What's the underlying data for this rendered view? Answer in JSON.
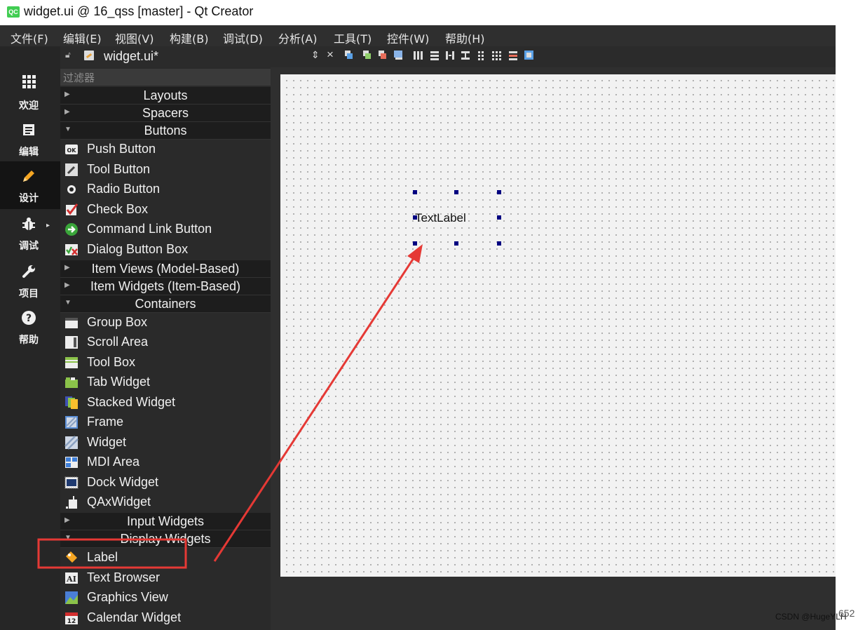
{
  "window": {
    "title": "widget.ui @ 16_qss [master] - Qt Creator",
    "logo_text": "QC"
  },
  "menu": [
    "文件(F)",
    "编辑(E)",
    "视图(V)",
    "构建(B)",
    "调试(D)",
    "分析(A)",
    "工具(T)",
    "控件(W)",
    "帮助(H)"
  ],
  "modes": [
    {
      "label": "欢迎",
      "icon": "grid-icon"
    },
    {
      "label": "编辑",
      "icon": "document-icon"
    },
    {
      "label": "设计",
      "icon": "pencil-icon"
    },
    {
      "label": "调试",
      "icon": "bug-icon"
    },
    {
      "label": "项目",
      "icon": "wrench-icon"
    },
    {
      "label": "帮助",
      "icon": "question-icon"
    }
  ],
  "document": {
    "file_name": "widget.ui*"
  },
  "widget_box": {
    "filter_placeholder": "过滤器",
    "categories": {
      "layouts": "Layouts",
      "spacers": "Spacers",
      "buttons": "Buttons",
      "item_views": "Item Views (Model-Based)",
      "item_widgets": "Item Widgets (Item-Based)",
      "containers": "Containers",
      "input_widgets": "Input Widgets",
      "display_widgets": "Display Widgets"
    },
    "buttons": [
      "Push Button",
      "Tool Button",
      "Radio Button",
      "Check Box",
      "Command Link Button",
      "Dialog Button Box"
    ],
    "containers": [
      "Group Box",
      "Scroll Area",
      "Tool Box",
      "Tab Widget",
      "Stacked Widget",
      "Frame",
      "Widget",
      "MDI Area",
      "Dock Widget",
      "QAxWidget"
    ],
    "display_widgets": [
      "Label",
      "Text Browser",
      "Graphics View",
      "Calendar Widget"
    ]
  },
  "form": {
    "label_text": "TextLabel"
  },
  "annotation": {
    "color": "#e53935"
  },
  "watermark": {
    "text": "CSDN @HugeYLH",
    "right_text": "652"
  }
}
